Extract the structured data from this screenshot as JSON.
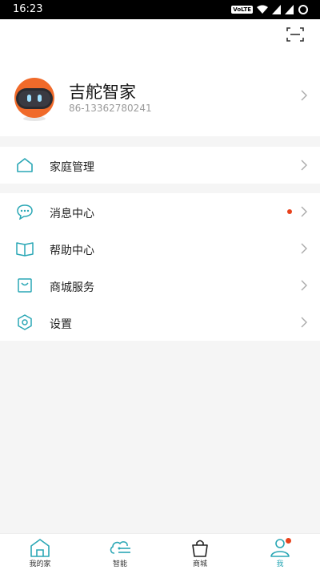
{
  "status_bar": {
    "time": "16:23",
    "volte": "VoLTE"
  },
  "profile": {
    "name": "吉舵智家",
    "phone": "86-13362780241"
  },
  "menu_group1": [
    {
      "label": "家庭管理",
      "icon": "home-outline-icon"
    }
  ],
  "menu_group2": [
    {
      "label": "消息中心",
      "icon": "chat-bubble-icon",
      "badge": true
    },
    {
      "label": "帮助中心",
      "icon": "book-icon"
    },
    {
      "label": "商城服务",
      "icon": "shopping-bag-icon"
    },
    {
      "label": "设置",
      "icon": "settings-hexagon-icon"
    }
  ],
  "tabs": [
    {
      "label": "我的家",
      "icon": "home-tab-icon"
    },
    {
      "label": "智能",
      "icon": "cloud-smart-icon"
    },
    {
      "label": "商城",
      "icon": "bag-tab-icon"
    },
    {
      "label": "我",
      "icon": "person-tab-icon",
      "active": true
    }
  ],
  "colors": {
    "accent": "#2aa7b5",
    "badge": "#e8421c"
  }
}
